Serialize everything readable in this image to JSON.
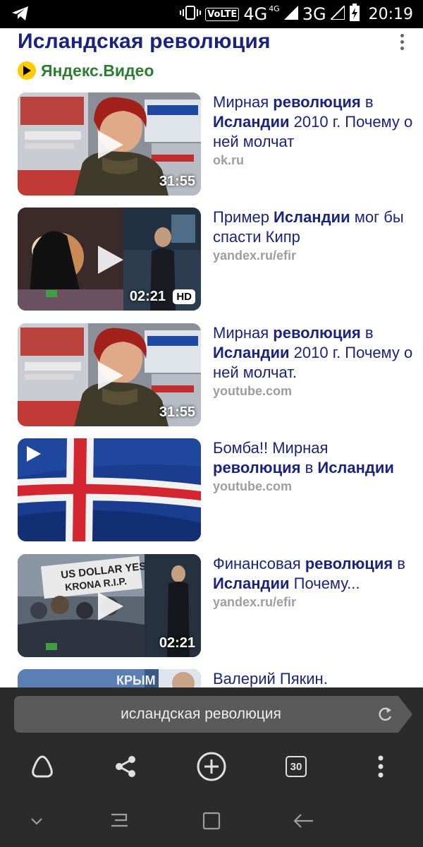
{
  "status_bar": {
    "network_label": "VoLTE",
    "network_4g": "4G",
    "network_4g_sup": "4G",
    "network_3g": "3G",
    "time": "20:19",
    "icons": [
      "telegram-icon",
      "vibrate-icon",
      "signal-icon",
      "battery-charging-icon"
    ]
  },
  "header": {
    "title": "Исландская революция",
    "source": "Яндекс.Видео",
    "more_icon": "more-vertical-icon"
  },
  "videos": [
    {
      "title_parts": [
        "Мирная ",
        "революция",
        " в ",
        "Исландии",
        " 2010 г. Почему о ней молчат"
      ],
      "source": "ok.ru",
      "duration": "31:55",
      "hd": ""
    },
    {
      "title_parts": [
        "Пример ",
        "Исландии",
        "",
        "",
        " мог бы спасти Кипр"
      ],
      "source": "yandex.ru/efir",
      "duration": "02:21",
      "hd": "HD"
    },
    {
      "title_parts": [
        "Мирная ",
        "революция",
        " в ",
        "Исландии",
        " 2010 г. Почему о ней молчат."
      ],
      "source": "youtube.com",
      "duration": "31:55",
      "hd": ""
    },
    {
      "title_parts": [
        "Бомба!! Мирная ",
        "революция",
        " в ",
        "Исландии",
        ""
      ],
      "source": "youtube.com",
      "duration": "",
      "hd": ""
    },
    {
      "title_parts": [
        "Финансовая ",
        "революция",
        " в ",
        "Исландии",
        " Почему..."
      ],
      "source": "yandex.ru/efir",
      "duration": "02:21",
      "hd": ""
    },
    {
      "title_parts": [
        "Валерий Пякин.",
        "",
        "",
        "",
        ""
      ],
      "source": "",
      "duration": "",
      "hd": ""
    }
  ],
  "thumbnail_text": {
    "t3_sign1": "US DOLLAR YES",
    "t3_sign2": "KRONA R.I.P.",
    "t5_text": "КРЫМ"
  },
  "browser": {
    "address": "исландская революция",
    "tab_count": "30",
    "icons": [
      "alice-icon",
      "share-icon",
      "new-tab-icon",
      "tabs-icon",
      "menu-icon",
      "reload-icon"
    ]
  },
  "nav": {
    "icons": [
      "chevron-down-icon",
      "recent-apps-icon",
      "home-icon",
      "back-icon"
    ]
  },
  "colors": {
    "title": "#1a237e",
    "source_label": "#2e7d32",
    "meta": "#9e9e9e",
    "bar_bg": "#2b2b2b",
    "badge": "#ffcc00"
  }
}
